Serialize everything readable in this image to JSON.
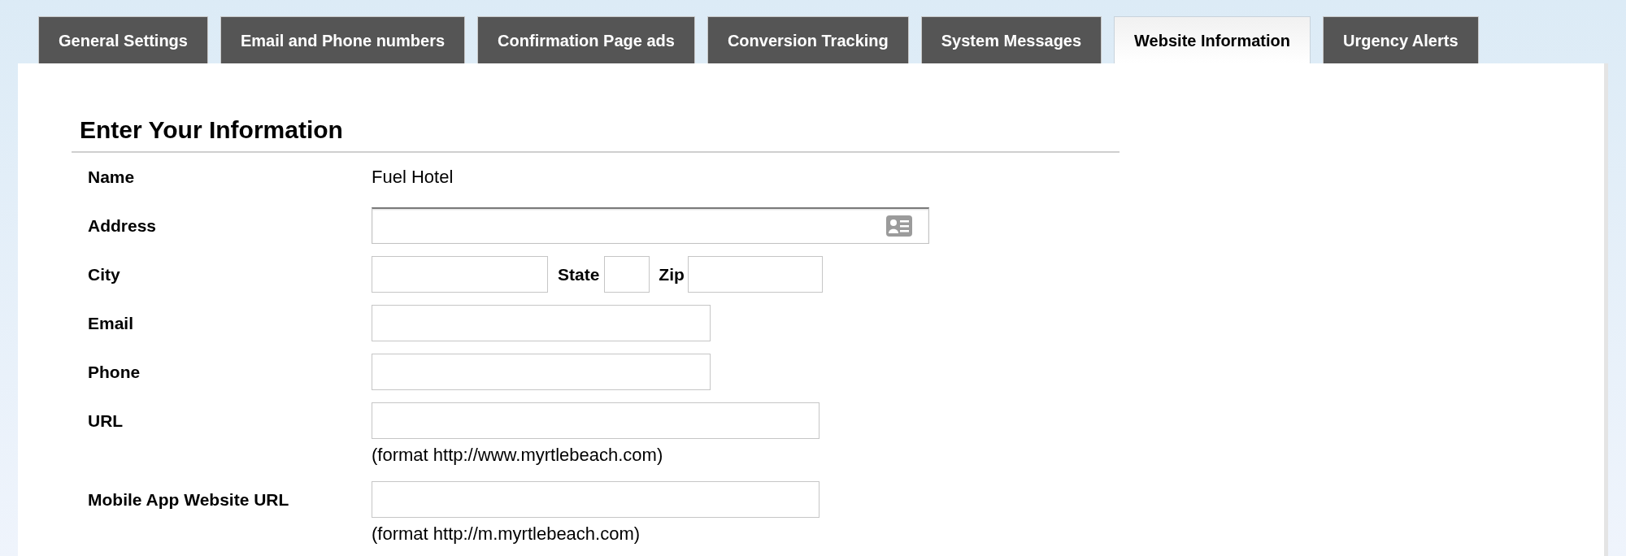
{
  "tabs": [
    {
      "label": "General Settings",
      "selected": false
    },
    {
      "label": "Email and Phone numbers",
      "selected": false
    },
    {
      "label": "Confirmation Page ads",
      "selected": false
    },
    {
      "label": "Conversion Tracking",
      "selected": false
    },
    {
      "label": "System Messages",
      "selected": false
    },
    {
      "label": "Website Information",
      "selected": true
    },
    {
      "label": "Urgency Alerts",
      "selected": false
    }
  ],
  "form": {
    "title": "Enter Your Information",
    "fields": [
      {
        "kind": "static",
        "label": "Name",
        "value": "Fuel Hotel"
      },
      {
        "kind": "address",
        "label": "Address"
      },
      {
        "kind": "location",
        "label": "City",
        "state_label": "State",
        "zip_label": "Zip"
      },
      {
        "kind": "short",
        "label": "Email"
      },
      {
        "kind": "short",
        "label": "Phone"
      },
      {
        "kind": "long",
        "label": "URL",
        "hint": "(format http://www.myrtlebeach.com)"
      },
      {
        "kind": "long",
        "label": "Mobile App Website URL",
        "hint": "(format http://m.myrtlebeach.com)"
      }
    ]
  }
}
